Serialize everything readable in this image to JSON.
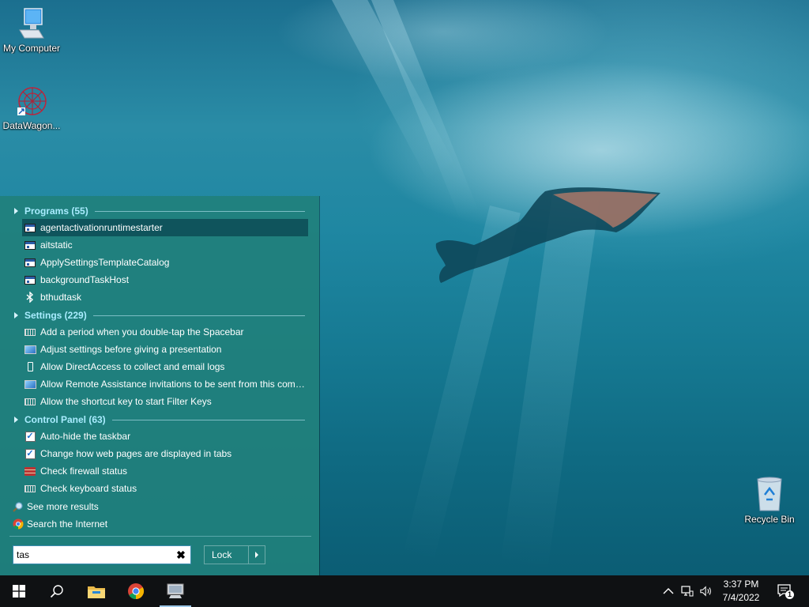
{
  "desktop": {
    "icons": [
      {
        "label": "My Computer"
      },
      {
        "label": "DataWagon..."
      },
      {
        "label": "Recycle Bin"
      }
    ]
  },
  "start_menu": {
    "groups": [
      {
        "title": "Programs (55)",
        "items": [
          {
            "label": "agentactivationruntimestarter",
            "icon": "app-window-icon",
            "selected": true
          },
          {
            "label": "aitstatic",
            "icon": "app-window-icon"
          },
          {
            "label": "ApplySettingsTemplateCatalog",
            "icon": "app-window-icon"
          },
          {
            "label": "backgroundTaskHost",
            "icon": "app-window-icon"
          },
          {
            "label": "bthudtask",
            "icon": "bluetooth-icon"
          }
        ]
      },
      {
        "title": "Settings (229)",
        "items": [
          {
            "label": "Add a period when you double-tap the Spacebar",
            "icon": "keyboard-icon"
          },
          {
            "label": "Adjust settings before giving a presentation",
            "icon": "presentation-icon"
          },
          {
            "label": "Allow DirectAccess to collect and email logs",
            "icon": "phone-icon"
          },
          {
            "label": "Allow Remote Assistance invitations to be sent from this comp...",
            "icon": "remote-assistance-icon"
          },
          {
            "label": "Allow the shortcut key to start Filter Keys",
            "icon": "keyboard-icon"
          }
        ]
      },
      {
        "title": "Control Panel (63)",
        "items": [
          {
            "label": "Auto-hide the taskbar",
            "icon": "checkbox-icon"
          },
          {
            "label": "Change how web pages are displayed in tabs",
            "icon": "checkbox-icon"
          },
          {
            "label": "Check firewall status",
            "icon": "firewall-icon"
          },
          {
            "label": "Check keyboard status",
            "icon": "keyboard-icon"
          }
        ]
      }
    ],
    "see_more": "See more results",
    "search_internet": "Search the Internet",
    "search": {
      "value": "tas",
      "clear_label": "✖"
    },
    "lock_label": "Lock"
  },
  "taskbar": {
    "icons": [
      "windows-start-icon",
      "search-icon",
      "file-explorer-icon",
      "chrome-icon",
      "computer-app-icon"
    ],
    "clock": {
      "time": "3:37 PM",
      "date": "7/4/2022"
    },
    "notification_count": "1"
  },
  "colors": {
    "start_menu_bg": "#20807c",
    "group_title": "#a9ecff",
    "taskbar_bg": "#0f1113"
  }
}
